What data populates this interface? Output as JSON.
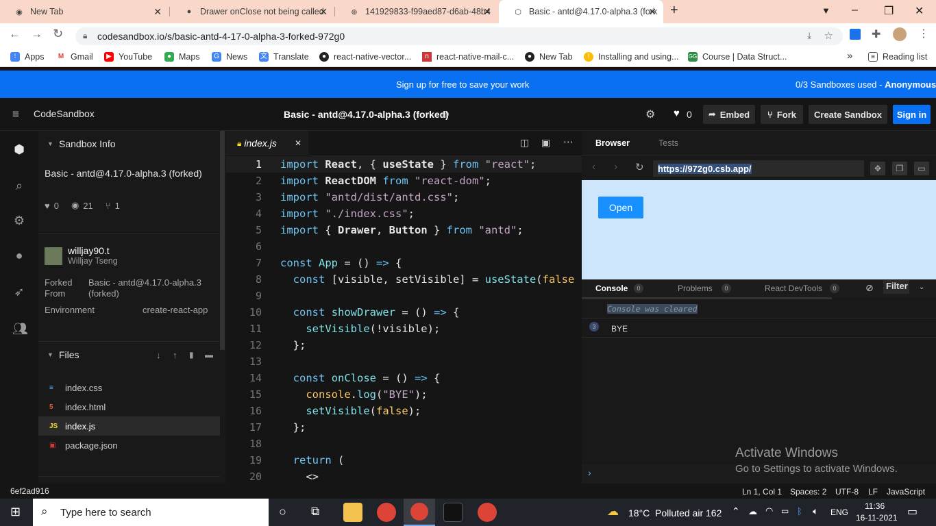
{
  "tabs": [
    {
      "title": "New Tab",
      "icon": "chrome-icon"
    },
    {
      "title": "Drawer onClose not being called",
      "icon": "github-icon"
    },
    {
      "title": "141929833-f99aed87-d6ab-48b4",
      "icon": "globe-icon"
    },
    {
      "title": "Basic - antd@4.17.0-alpha.3 (fork",
      "icon": "codesandbox-icon"
    }
  ],
  "address": {
    "url": "codesandbox.io/s/basic-antd-4-17-0-alpha-3-forked-972g0"
  },
  "bookmarks": [
    "Apps",
    "Gmail",
    "YouTube",
    "Maps",
    "News",
    "Translate",
    "react-native-vector...",
    "react-native-mail-c...",
    "New Tab",
    "Installing and using...",
    "Course | Data Struct..."
  ],
  "bookmarks_more": "»",
  "reading_list": "Reading list",
  "banner": {
    "text": "Sign up for free to save your work",
    "quota": "0/3 Sandboxes used - ",
    "user": "Anonymous"
  },
  "header": {
    "brand": "CodeSandbox",
    "title": "Basic - antd@4.17.0-alpha.3 (forked)",
    "likes": "0",
    "embed": "Embed",
    "fork": "Fork",
    "create": "Create Sandbox",
    "signin": "Sign in"
  },
  "sidebar": {
    "info_title": "Sandbox Info",
    "sandbox_name": "Basic - antd@4.17.0-alpha.3 (forked)",
    "likes": "0",
    "views": "21",
    "forks": "1",
    "user": "willjay90.t",
    "user_name": "Willjay Tseng",
    "forked_label": "Forked\nFrom",
    "forked_value": "Basic - antd@4.17.0-alpha.3\n(forked)",
    "env_label": "Environment",
    "env_value": "create-react-app",
    "files_title": "Files",
    "files": [
      {
        "name": "index.css",
        "icon": "css-icon",
        "color": "#5fb3ff"
      },
      {
        "name": "index.html",
        "icon": "html-icon",
        "color": "#e4572e"
      },
      {
        "name": "index.js",
        "icon": "js-icon",
        "color": "#f7df1e"
      },
      {
        "name": "package.json",
        "icon": "npm-icon",
        "color": "#d63b3b"
      }
    ]
  },
  "editor": {
    "tab": "index.js",
    "lines": [
      {
        "n": "1",
        "html": "<span class='k'>import</span> <span class='b'>React</span>, { <span class='b'>useState</span> } <span class='k'>from</span> <span class='s'>\"react\"</span>;"
      },
      {
        "n": "2",
        "html": "<span class='k'>import</span> <span class='b'>ReactDOM</span> <span class='k'>from</span> <span class='s'>\"react-dom\"</span>;"
      },
      {
        "n": "3",
        "html": "<span class='k'>import</span> <span class='s'>\"antd/dist/antd.css\"</span>;"
      },
      {
        "n": "4",
        "html": "<span class='k'>import</span> <span class='s'>\"./index.css\"</span>;"
      },
      {
        "n": "5",
        "html": "<span class='k'>import</span> { <span class='b'>Drawer</span>, <span class='b'>Button</span> } <span class='k'>from</span> <span class='s'>\"antd\"</span>;"
      },
      {
        "n": "6",
        "html": ""
      },
      {
        "n": "7",
        "html": "<span class='k'>const</span> <span class='f'>App</span> = () <span class='k'>=&gt;</span> {"
      },
      {
        "n": "8",
        "html": "  <span class='k'>const</span> [visible, setVisible] = <span class='f'>useState</span>(<span class='y'>false</span>"
      },
      {
        "n": "9",
        "html": ""
      },
      {
        "n": "10",
        "html": "  <span class='k'>const</span> <span class='f'>showDrawer</span> = () <span class='k'>=&gt;</span> {"
      },
      {
        "n": "11",
        "html": "    <span class='f'>setVisible</span>(!visible);"
      },
      {
        "n": "12",
        "html": "  };"
      },
      {
        "n": "13",
        "html": ""
      },
      {
        "n": "14",
        "html": "  <span class='k'>const</span> <span class='f'>onClose</span> = () <span class='k'>=&gt;</span> {"
      },
      {
        "n": "15",
        "html": "    <span class='y'>console</span>.<span class='f'>log</span>(<span class='s'>\"BYE\"</span>);"
      },
      {
        "n": "16",
        "html": "    <span class='f'>setVisible</span>(<span class='y'>false</span>);"
      },
      {
        "n": "17",
        "html": "  };"
      },
      {
        "n": "18",
        "html": ""
      },
      {
        "n": "19",
        "html": "  <span class='k'>return</span> ("
      },
      {
        "n": "20",
        "html": "    &lt;&gt;"
      }
    ]
  },
  "browser": {
    "tab_browser": "Browser",
    "tab_tests": "Tests",
    "url": "https://972g0.csb.app/",
    "open_button": "Open",
    "console_tab": "Console",
    "console_count": "0",
    "problems_tab": "Problems",
    "problems_count": "0",
    "devtools_tab": "React DevTools",
    "devtools_count": "0",
    "filter": "Filter",
    "cleared": "Console was cleared",
    "log_count": "3",
    "log_text": "BYE",
    "prompt": "›"
  },
  "status": {
    "hash": "6ef2ad916",
    "position": "Ln 1, Col 1",
    "spaces": "Spaces: 2",
    "encoding": "UTF-8",
    "eol": "LF",
    "language": "JavaScript"
  },
  "watermark": {
    "line1": "Activate Windows",
    "line2": "Go to Settings to activate Windows."
  },
  "taskbar": {
    "search": "Type here to search",
    "weather": "18°C  Polluted air 162",
    "lang": "ENG",
    "time": "11:36",
    "date": "16-11-2021"
  },
  "colors": {
    "accent": "#0971f1",
    "preview_bg": "#cde6fb",
    "antd_button": "#1890ff"
  }
}
